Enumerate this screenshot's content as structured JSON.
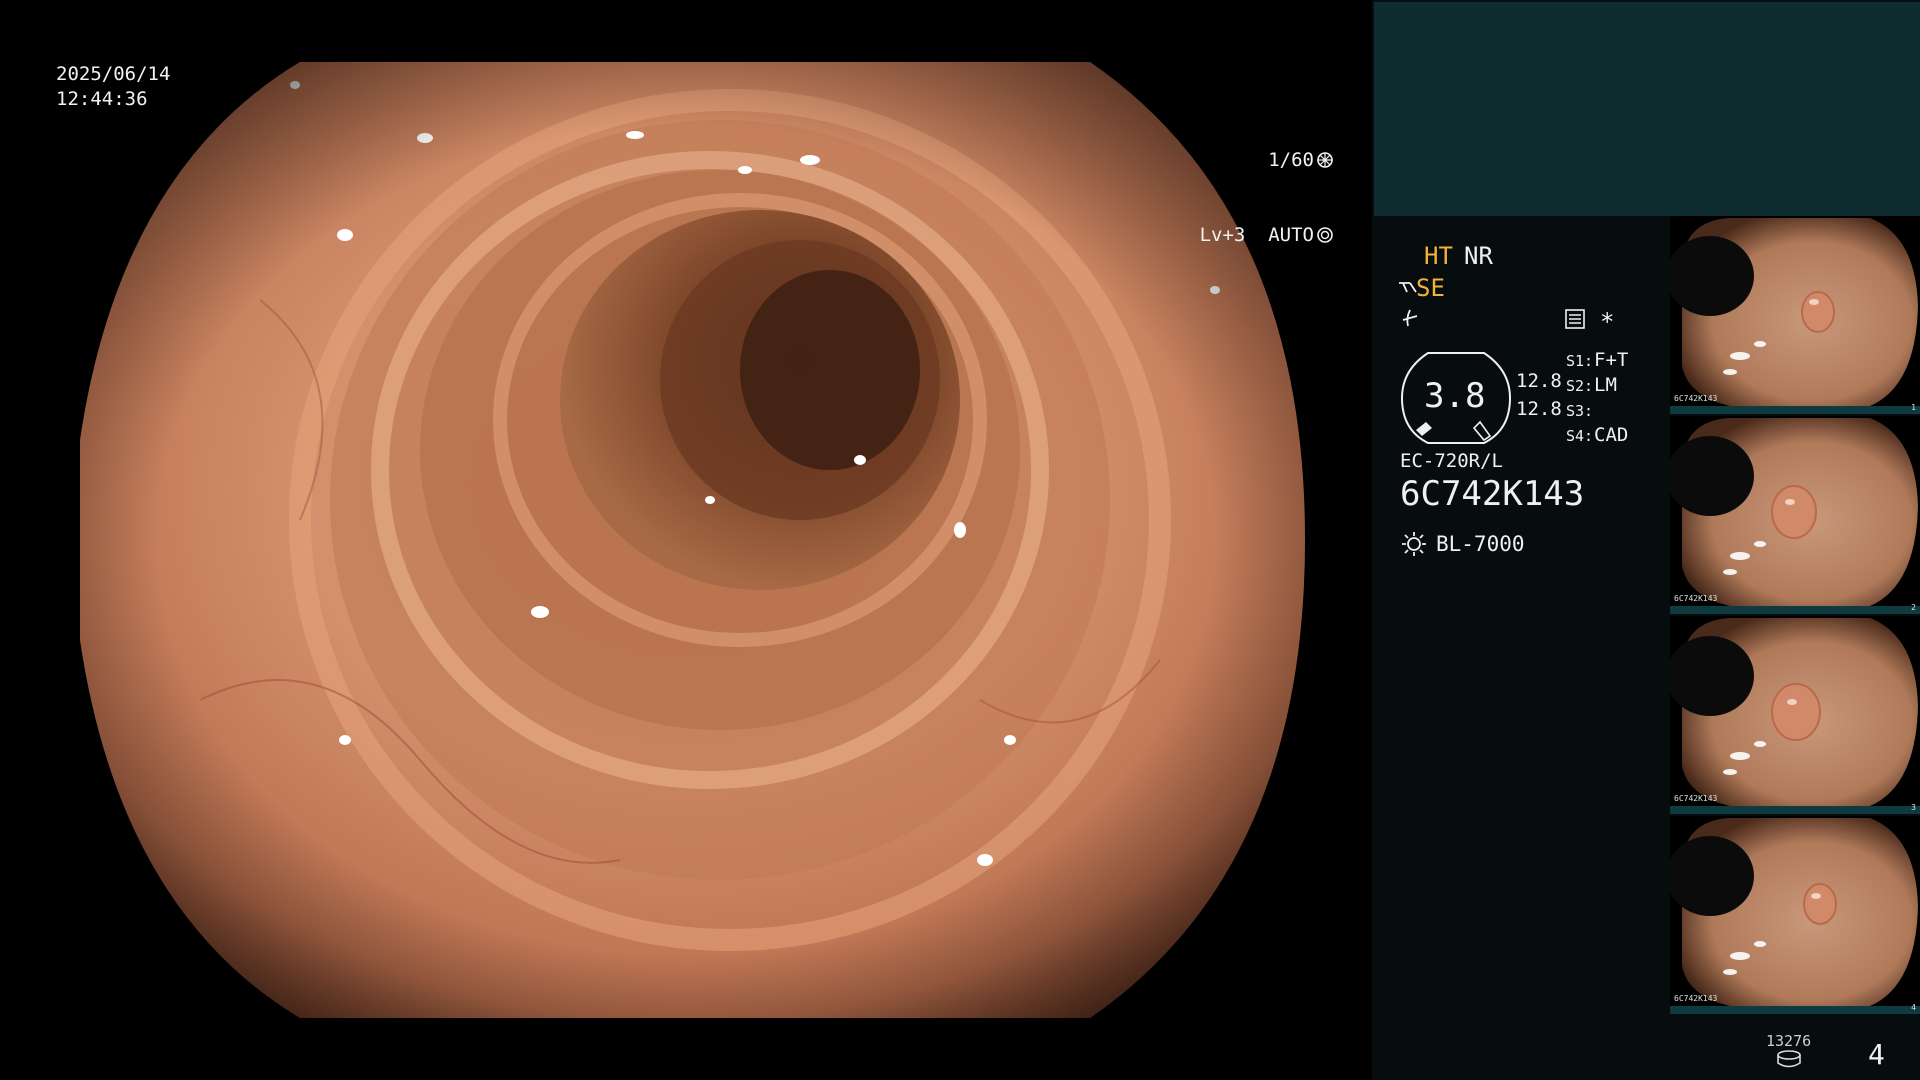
{
  "osd": {
    "date": "2025/06/14",
    "time": "12:44:36",
    "shutter": "1/60",
    "level_mode": "Lv+3  AUTO"
  },
  "panel": {
    "ht": "HT",
    "nr": "NR",
    "se": "SE",
    "zoom_value": "3.8",
    "value_a": "12.8",
    "value_b": "12.8",
    "s1_label": "S1:",
    "s1_value": "F+T",
    "s2_label": "S2:",
    "s2_value": "LM",
    "s3_label": "S3:",
    "s3_value": "",
    "s4_label": "S4:",
    "s4_value": "CAD",
    "scope_model": "EC-720R/L",
    "scope_serial": "6C742K143",
    "light_source": "BL-7000",
    "storage_count": "13276",
    "capture_count": "4",
    "asterisk": "*"
  },
  "thumbnails": [
    {
      "label": "6C742K143",
      "index": "1"
    },
    {
      "label": "6C742K143",
      "index": "2"
    },
    {
      "label": "6C742K143",
      "index": "3"
    },
    {
      "label": "6C742K143",
      "index": "4"
    }
  ],
  "icons": {
    "shutter": "aperture-icon",
    "auto": "iris-icon",
    "scope_se": "scope-tip-icon",
    "freeze": "freeze-icon",
    "settings": "settings-list-icon",
    "light": "light-source-icon",
    "storage": "storage-icon"
  }
}
